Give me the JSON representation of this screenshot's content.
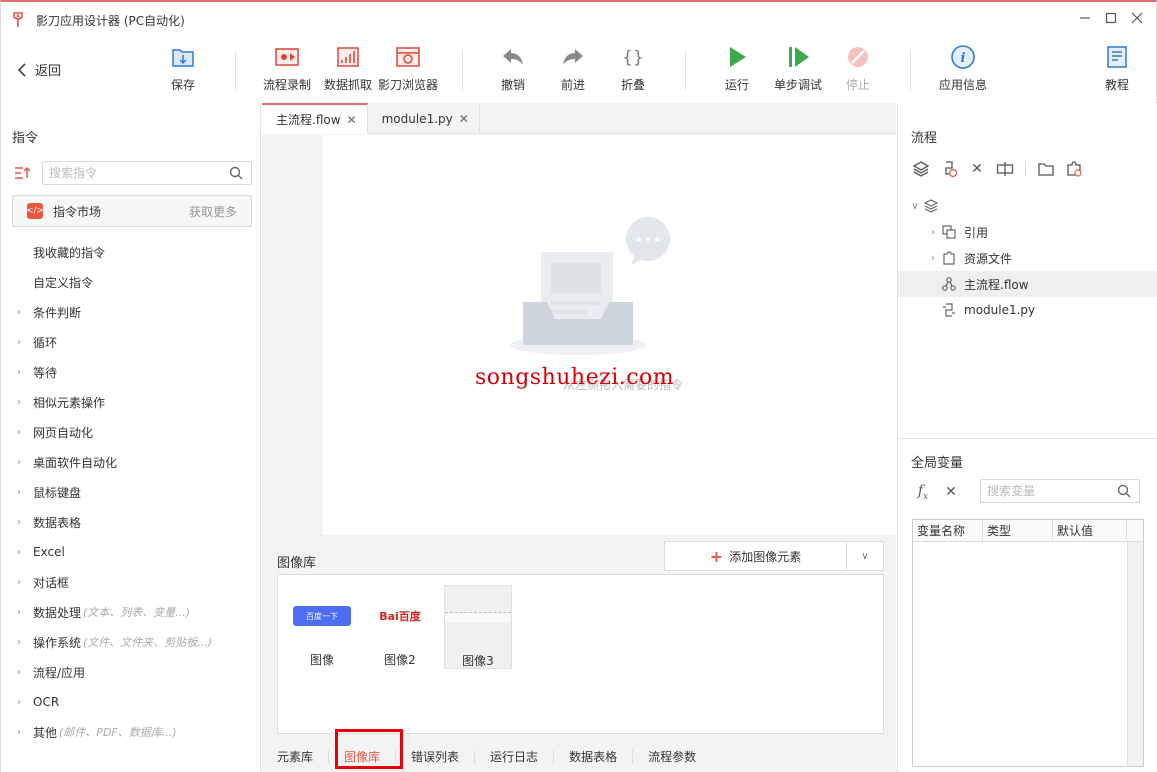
{
  "window": {
    "title": "影刀应用设计器 (PC自动化)",
    "controls": [
      "minimize",
      "maximize",
      "close"
    ]
  },
  "toolbar": {
    "back_label": "返回",
    "buttons": [
      {
        "label": "保存",
        "icon": "save-icon"
      },
      {
        "label": "流程录制",
        "icon": "record-icon"
      },
      {
        "label": "数据抓取",
        "icon": "data-scrape-icon"
      },
      {
        "label": "影刀浏览器",
        "icon": "browser-icon"
      },
      {
        "label": "撤销",
        "icon": "undo-icon"
      },
      {
        "label": "前进",
        "icon": "redo-icon"
      },
      {
        "label": "折叠",
        "icon": "fold-icon"
      },
      {
        "label": "运行",
        "icon": "run-icon"
      },
      {
        "label": "单步调试",
        "icon": "step-debug-icon"
      },
      {
        "label": "停止",
        "icon": "stop-icon",
        "disabled": true
      },
      {
        "label": "应用信息",
        "icon": "info-icon"
      },
      {
        "label": "教程",
        "icon": "tutorial-icon"
      }
    ]
  },
  "left_panel": {
    "title": "指令",
    "search_placeholder": "搜索指令",
    "market_label": "指令市场",
    "market_more": "获取更多",
    "items": [
      {
        "label": "我收藏的指令",
        "expandable": false,
        "hint": ""
      },
      {
        "label": "自定义指令",
        "expandable": false,
        "hint": ""
      },
      {
        "label": "条件判断",
        "expandable": true,
        "hint": ""
      },
      {
        "label": "循环",
        "expandable": true,
        "hint": ""
      },
      {
        "label": "等待",
        "expandable": true,
        "hint": ""
      },
      {
        "label": "相似元素操作",
        "expandable": true,
        "hint": ""
      },
      {
        "label": "网页自动化",
        "expandable": true,
        "hint": ""
      },
      {
        "label": "桌面软件自动化",
        "expandable": true,
        "hint": ""
      },
      {
        "label": "鼠标键盘",
        "expandable": true,
        "hint": ""
      },
      {
        "label": "数据表格",
        "expandable": true,
        "hint": ""
      },
      {
        "label": "Excel",
        "expandable": true,
        "hint": ""
      },
      {
        "label": "对话框",
        "expandable": true,
        "hint": ""
      },
      {
        "label": "数据处理",
        "expandable": true,
        "hint": "(文本、列表、变量...)"
      },
      {
        "label": "操作系统",
        "expandable": true,
        "hint": "(文件、文件夹、剪贴板...)"
      },
      {
        "label": "流程/应用",
        "expandable": true,
        "hint": ""
      },
      {
        "label": "OCR",
        "expandable": true,
        "hint": ""
      },
      {
        "label": "其他",
        "expandable": true,
        "hint": "(邮件、PDF、数据库...)"
      }
    ]
  },
  "editor": {
    "tabs": [
      {
        "label": "主流程.flow",
        "active": true
      },
      {
        "label": "module1.py",
        "active": false
      }
    ],
    "empty_hint": "从左侧拖入需要的指令",
    "watermark": "songshuhezi.com"
  },
  "image_library": {
    "title": "图像库",
    "add_label": "添加图像元素",
    "images": [
      {
        "caption": "图像",
        "preview_text": "百度一下",
        "selected": false
      },
      {
        "caption": "图像2",
        "preview_text": "Bai百度",
        "selected": false
      },
      {
        "caption": "图像3",
        "preview_text": "",
        "selected": true
      }
    ],
    "bottom_tabs": [
      {
        "label": "元素库",
        "active": false
      },
      {
        "label": "图像库",
        "active": true
      },
      {
        "label": "错误列表",
        "active": false
      },
      {
        "label": "运行日志",
        "active": false
      },
      {
        "label": "数据表格",
        "active": false
      },
      {
        "label": "流程参数",
        "active": false
      }
    ]
  },
  "right_panel": {
    "flow_title": "流程",
    "tree": [
      {
        "label": "",
        "level": 0,
        "icon": "layers-icon",
        "expanded": true
      },
      {
        "label": "引用",
        "level": 1,
        "icon": "reference-icon",
        "expandable": true
      },
      {
        "label": "资源文件",
        "level": 1,
        "icon": "resource-icon",
        "expandable": true
      },
      {
        "label": "主流程.flow",
        "level": 1,
        "icon": "flow-file-icon",
        "selected": true
      },
      {
        "label": "module1.py",
        "level": 1,
        "icon": "python-icon"
      }
    ],
    "vars_title": "全局变量",
    "var_search_placeholder": "搜索变量",
    "var_columns": [
      "变量名称",
      "类型",
      "默认值"
    ]
  },
  "colors": {
    "accent": "#e05a4a",
    "highlight_box": "#e8000b",
    "run_green": "#3caa4c",
    "info_blue": "#2b7bd6"
  }
}
